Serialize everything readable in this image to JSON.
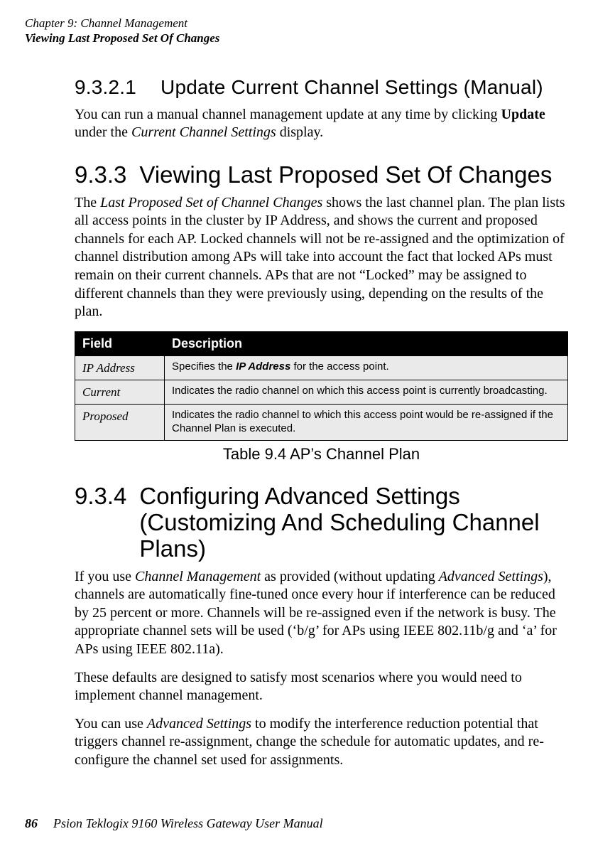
{
  "header": {
    "chapter": "Chapter 9:  Channel Management",
    "section": "Viewing Last Proposed Set Of Changes"
  },
  "sec_9_3_2_1": {
    "num": "9.3.2.1",
    "title": "Update Current Channel Settings (Manual)",
    "p1_a": "You can run a manual channel management update at any time by clicking ",
    "p1_b": "Update",
    "p1_c": " under the ",
    "p1_d": "Current Channel Settings",
    "p1_e": " display."
  },
  "sec_9_3_3": {
    "num": "9.3.3",
    "title": "Viewing Last Proposed Set Of Changes",
    "p1_a": "The ",
    "p1_b": "Last Proposed Set of Channel Changes",
    "p1_c": " shows the last channel plan. The plan lists all access points in the cluster by IP Address, and shows the current and pro­posed channels for each AP. Locked channels will not be re-assigned and the optimization of channel distribution among APs will take into account the fact that locked APs must remain on their current channels. APs that are not “Locked” may be assigned to different channels than they were previously using, depending on the results of the plan.",
    "table": {
      "head_field": "Field",
      "head_desc": "Description",
      "rows": [
        {
          "field": "IP Address",
          "desc_a": "Specifies the ",
          "desc_b": "IP Address",
          "desc_c": " for the access point."
        },
        {
          "field": "Current",
          "desc_a": "Indicates the radio channel on which this access point is currently broadcasting.",
          "desc_b": "",
          "desc_c": ""
        },
        {
          "field": "Proposed",
          "desc_a": "Indicates the radio channel to which this access point would be re-assigned if the Channel Plan is exe­cuted.",
          "desc_b": "",
          "desc_c": ""
        }
      ],
      "caption": "Table 9.4 AP’s Channel Plan"
    }
  },
  "sec_9_3_4": {
    "num": "9.3.4",
    "title": "Configuring Advanced Settings (Customizing And Scheduling Channel Plans)",
    "p1_a": "If you use ",
    "p1_b": "Channel Management",
    "p1_c": " as provided (without updating ",
    "p1_d": "Advanced Settings",
    "p1_e": "), channels are automatically fine-tuned once every hour if interference can be reduced by 25 percent or more. Channels will be re-assigned even if the network is busy. The appropriate channel sets will be used (‘b/g’ for APs using IEEE 802.11b/g and ‘a’ for APs using IEEE 802.11a).",
    "p2": "These defaults are designed to satisfy most scenarios where you would need to implement channel management.",
    "p3_a": "You can use ",
    "p3_b": "Advanced Settings",
    "p3_c": " to modify the interference reduction potential that triggers channel re-assignment, change the schedule for automatic updates, and re-configure the channel set used for assignments."
  },
  "footer": {
    "page": "86",
    "manual": "Psion Teklogix 9160 Wireless Gateway User Manual"
  }
}
